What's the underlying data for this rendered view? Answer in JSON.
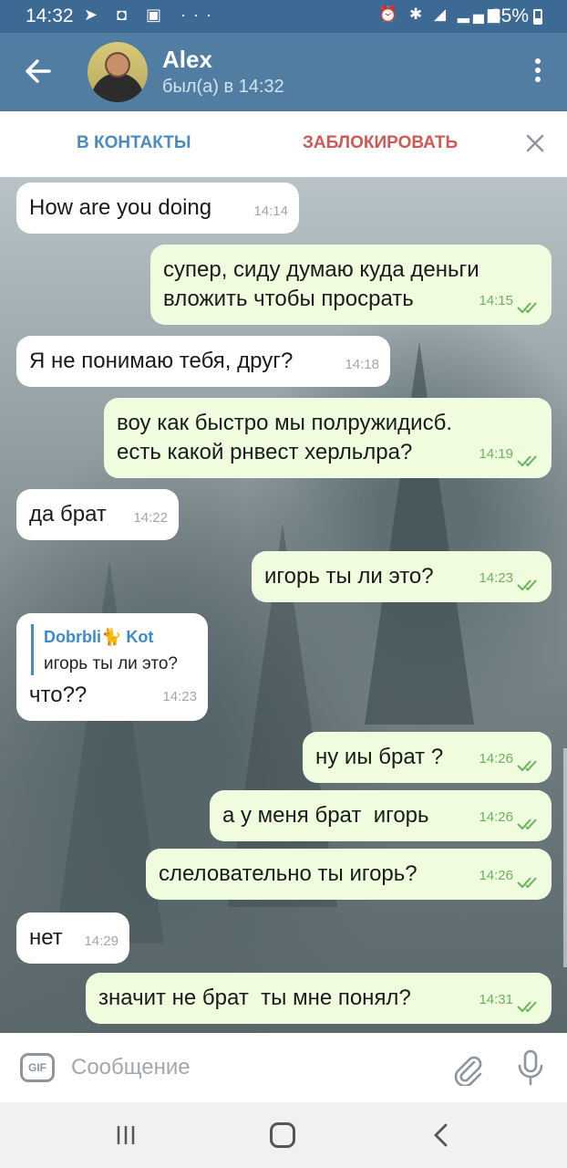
{
  "status_bar": {
    "time": "14:32",
    "battery": "35%"
  },
  "header": {
    "name": "Alex",
    "last_seen": "был(а) в 14:32"
  },
  "action_bar": {
    "add_contact": "В КОНТАКТЫ",
    "block": "ЗАБЛОКИРОВАТЬ"
  },
  "messages": [
    {
      "dir": "in",
      "text": "How are you doing",
      "time": "14:14"
    },
    {
      "dir": "out",
      "text": "супер, сиду думаю куда деньги вложить чтобы просрать",
      "line1": "супер, сиду думаю куда деньги",
      "line2": "вложить чтобы просрать",
      "time": "14:15"
    },
    {
      "dir": "in",
      "text": "Я не понимаю тебя, друг?",
      "time": "14:18"
    },
    {
      "dir": "out",
      "text": "воу как быстро мы полружидисб. есть какой рнвест херльлра?",
      "line1": "воу как быстро мы полружидисб.",
      "line2": "есть какой рнвест херльлра?",
      "time": "14:19"
    },
    {
      "dir": "in",
      "text": "да брат",
      "time": "14:22"
    },
    {
      "dir": "out",
      "text": "игорь ты ли это?",
      "time": "14:23"
    },
    {
      "dir": "in",
      "reply_to_name": "Dobrbli🐈 Kot",
      "reply_to_text": "игорь ты ли это?",
      "text": "что??",
      "time": "14:23"
    },
    {
      "dir": "out",
      "text": "ну иы брат ?",
      "time": "14:26"
    },
    {
      "dir": "out",
      "text": "а у меня брат  игорь",
      "time": "14:26"
    },
    {
      "dir": "out",
      "text": "слеловательно ты игорь?",
      "time": "14:26"
    },
    {
      "dir": "in",
      "text": "нет",
      "time": "14:29"
    },
    {
      "dir": "out",
      "text": "значит не брат  ты мне понял?",
      "time": "14:31"
    }
  ],
  "input": {
    "placeholder": "Сообщение",
    "gif_label": "GIF"
  },
  "icons": {
    "back": "arrow-left-icon",
    "menu": "more-vertical-icon",
    "close": "close-icon",
    "gif": "gif-icon",
    "attach": "paperclip-icon",
    "mic": "microphone-icon",
    "read": "double-check-icon"
  },
  "colors": {
    "header": "#517da2",
    "outgoing": "#effdde",
    "incoming": "#ffffff",
    "block": "#cf5a55",
    "add": "#4a8bc2"
  }
}
